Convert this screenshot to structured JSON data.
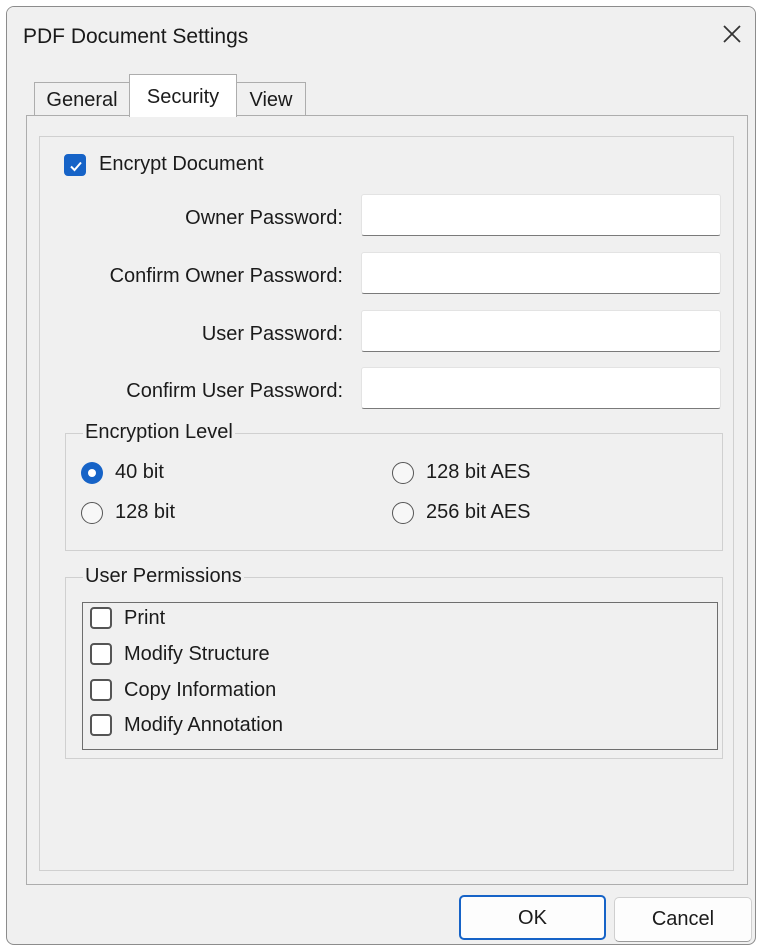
{
  "window": {
    "title": "PDF Document Settings",
    "close_icon": "close-icon"
  },
  "tabs": [
    {
      "label": "General",
      "selected": false
    },
    {
      "label": "Security",
      "selected": true
    },
    {
      "label": "View",
      "selected": false
    }
  ],
  "security": {
    "encrypt": {
      "label": "Encrypt Document",
      "checked": true
    },
    "fields": [
      {
        "label": "Owner Password:",
        "value": ""
      },
      {
        "label": "Confirm Owner Password:",
        "value": ""
      },
      {
        "label": "User Password:",
        "value": ""
      },
      {
        "label": "Confirm User Password:",
        "value": ""
      }
    ],
    "encryption_level": {
      "title": "Encryption Level",
      "options": [
        {
          "label": "40 bit",
          "selected": true
        },
        {
          "label": "128 bit",
          "selected": false
        },
        {
          "label": "128 bit AES",
          "selected": false
        },
        {
          "label": "256 bit AES",
          "selected": false
        }
      ]
    },
    "permissions": {
      "title": "User Permissions",
      "items": [
        {
          "label": "Print",
          "checked": false
        },
        {
          "label": "Modify Structure",
          "checked": false
        },
        {
          "label": "Copy Information",
          "checked": false
        },
        {
          "label": "Modify Annotation",
          "checked": false
        }
      ]
    }
  },
  "buttons": {
    "ok": "OK",
    "cancel": "Cancel"
  },
  "colors": {
    "accent": "#1663c7",
    "dialog_bg": "#f0f0f0"
  }
}
